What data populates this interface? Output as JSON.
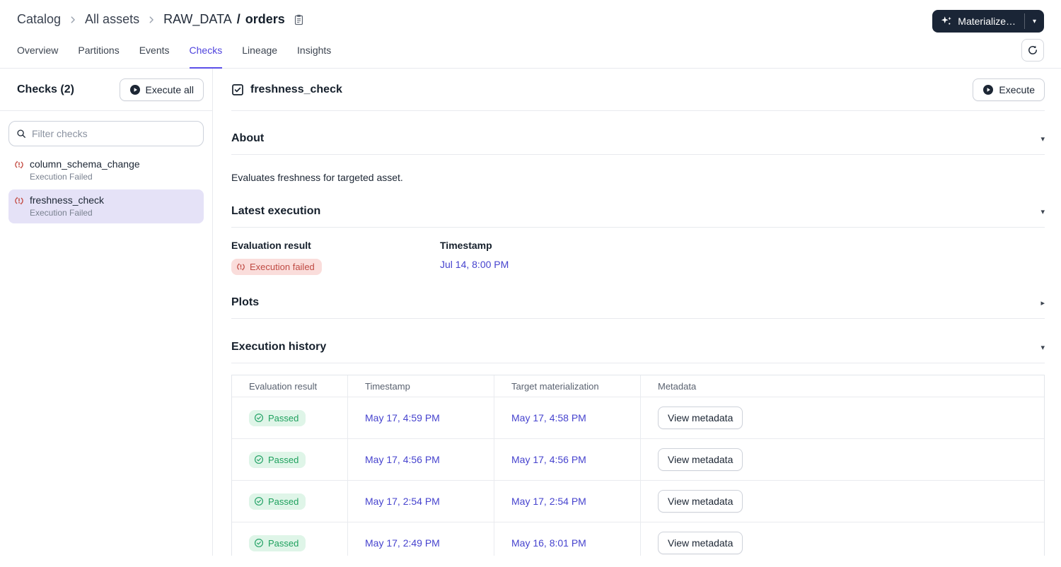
{
  "breadcrumb": {
    "crumb1": "Catalog",
    "crumb2": "All assets",
    "asset_group": "RAW_DATA",
    "slash": "/",
    "asset_name": "orders"
  },
  "header_actions": {
    "materialize_label": "Materialize…"
  },
  "tabs": [
    {
      "label": "Overview",
      "active": false
    },
    {
      "label": "Partitions",
      "active": false
    },
    {
      "label": "Events",
      "active": false
    },
    {
      "label": "Checks",
      "active": true
    },
    {
      "label": "Lineage",
      "active": false
    },
    {
      "label": "Insights",
      "active": false
    }
  ],
  "sidebar": {
    "title": "Checks (2)",
    "execute_all_label": "Execute all",
    "filter_placeholder": "Filter checks",
    "items": [
      {
        "name": "column_schema_change",
        "status": "Execution Failed",
        "selected": false
      },
      {
        "name": "freshness_check",
        "status": "Execution Failed",
        "selected": true
      }
    ]
  },
  "main": {
    "title": "freshness_check",
    "execute_label": "Execute",
    "about": {
      "heading": "About",
      "body": "Evaluates freshness for targeted asset."
    },
    "latest": {
      "heading": "Latest execution",
      "eval_label": "Evaluation result",
      "ts_label": "Timestamp",
      "badge": "Execution failed",
      "timestamp": "Jul 14, 8:00 PM"
    },
    "plots": {
      "heading": "Plots"
    },
    "history": {
      "heading": "Execution history",
      "columns": [
        "Evaluation result",
        "Timestamp",
        "Target materialization",
        "Metadata"
      ],
      "rows": [
        {
          "result": "Passed",
          "timestamp": "May 17, 4:59 PM",
          "target": "May 17, 4:58 PM",
          "metadata_label": "View metadata"
        },
        {
          "result": "Passed",
          "timestamp": "May 17, 4:56 PM",
          "target": "May 17, 4:56 PM",
          "metadata_label": "View metadata"
        },
        {
          "result": "Passed",
          "timestamp": "May 17, 2:54 PM",
          "target": "May 17, 2:54 PM",
          "metadata_label": "View metadata"
        },
        {
          "result": "Passed",
          "timestamp": "May 17, 2:49 PM",
          "target": "May 16, 8:01 PM",
          "metadata_label": "View metadata"
        }
      ]
    }
  },
  "colors": {
    "accent": "#4f43dd",
    "link": "#4643ce",
    "danger": "#bf4a43",
    "danger_bg": "#fadddb",
    "success": "#1fa15e",
    "success_bg": "#dff5e8",
    "selected_bg": "#e5e2f7",
    "dark_button_bg": "#1a2536"
  }
}
